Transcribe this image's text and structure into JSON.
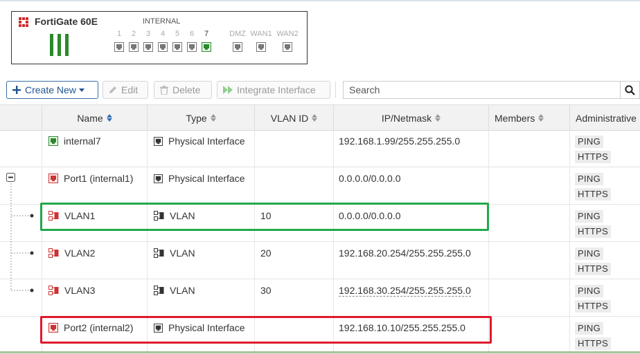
{
  "device": {
    "name": "FortiGate 60E",
    "group_internal": "INTERNAL",
    "internal_ports": [
      "1",
      "2",
      "3",
      "4",
      "5",
      "6",
      "7"
    ],
    "wan_ports": [
      "DMZ",
      "WAN1",
      "WAN2"
    ]
  },
  "toolbar": {
    "create_new": "Create New",
    "edit": "Edit",
    "delete": "Delete",
    "integrate": "Integrate Interface",
    "search_placeholder": "Search"
  },
  "columns": [
    "Name",
    "Type",
    "VLAN ID",
    "IP/Netmask",
    "Members",
    "Administrative"
  ],
  "rows": [
    {
      "name": "internal7",
      "type": "Physical Interface",
      "vlan_id": "",
      "ip": "192.168.1.99/255.255.255.0",
      "admin": [
        "PING",
        "HTTPS"
      ]
    },
    {
      "name": "Port1 (internal1)",
      "type": "Physical Interface",
      "vlan_id": "",
      "ip": "0.0.0.0/0.0.0.0",
      "admin": [
        "PING",
        "HTTPS"
      ]
    },
    {
      "name": "VLAN1",
      "type": "VLAN",
      "vlan_id": "10",
      "ip": "0.0.0.0/0.0.0.0",
      "admin": [
        "PING",
        "HTTPS"
      ]
    },
    {
      "name": "VLAN2",
      "type": "VLAN",
      "vlan_id": "20",
      "ip": "192.168.20.254/255.255.255.0",
      "admin": [
        "PING",
        "HTTPS"
      ]
    },
    {
      "name": "VLAN3",
      "type": "VLAN",
      "vlan_id": "30",
      "ip": "192.168.30.254/255.255.255.0",
      "admin": [
        "PING",
        "HTTPS"
      ]
    },
    {
      "name": "Port2 (internal2)",
      "type": "Physical Interface",
      "vlan_id": "",
      "ip": "192.168.10.10/255.255.255.0",
      "admin": [
        "PING",
        "HTTPS"
      ]
    }
  ],
  "colors": {
    "accent": "#1e5592",
    "port_up": "#2a8a2a",
    "port_down": "#cc3333",
    "highlight_green": "#22a84a",
    "highlight_red": "#e0192b"
  }
}
